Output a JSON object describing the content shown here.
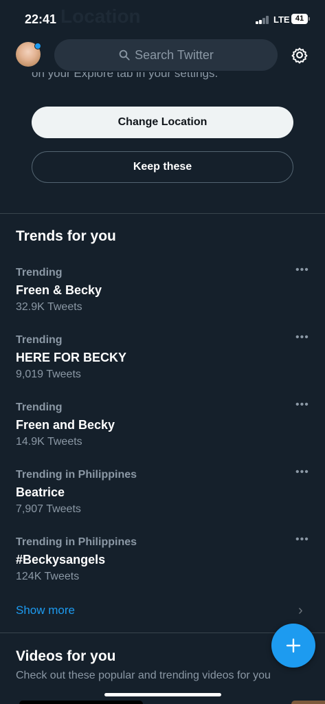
{
  "status_bar": {
    "time": "22:41",
    "network": "LTE",
    "battery": "41"
  },
  "background_title": "Location",
  "header": {
    "search_placeholder": "Search Twitter"
  },
  "location_prompt": {
    "partial_text": "on your Explore tab in your settings.",
    "change_button": "Change Location",
    "keep_button": "Keep these"
  },
  "trends": {
    "title": "Trends for you",
    "items": [
      {
        "context": "Trending",
        "name": "Freen & Becky",
        "count": "32.9K Tweets"
      },
      {
        "context": "Trending",
        "name": "HERE FOR BECKY",
        "count": "9,019 Tweets"
      },
      {
        "context": "Trending",
        "name": "Freen and Becky",
        "count": "14.9K Tweets"
      },
      {
        "context": "Trending in Philippines",
        "name": "Beatrice",
        "count": "7,907 Tweets"
      },
      {
        "context": "Trending in Philippines",
        "name": "#Beckysangels",
        "count": "124K Tweets"
      }
    ],
    "show_more": "Show more"
  },
  "videos": {
    "title": "Videos for you",
    "subtitle": "Check out these popular and trending videos for you"
  },
  "icons": {
    "search": "search-icon",
    "settings": "gear-icon",
    "more": "more-horizontal-icon",
    "chevron": "chevron-right-icon",
    "compose": "plus-icon"
  },
  "colors": {
    "background": "#15202b",
    "accent": "#1d9bf0",
    "secondary_text": "#8b98a5"
  }
}
